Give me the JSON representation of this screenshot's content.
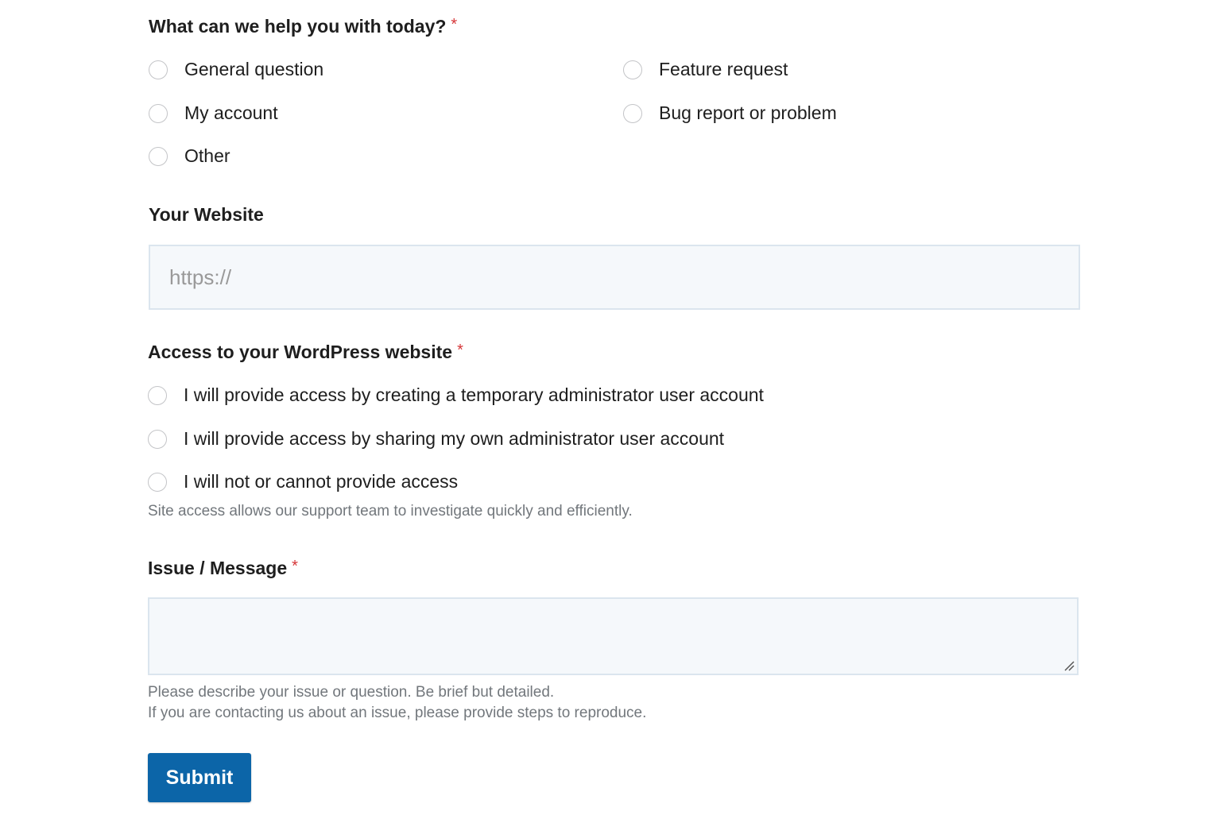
{
  "help_section": {
    "label": "What can we help you with today?",
    "required_mark": "*",
    "options": [
      {
        "label": "General question",
        "checked": false
      },
      {
        "label": "Feature request",
        "checked": false
      },
      {
        "label": "My account",
        "checked": false
      },
      {
        "label": "Bug report or problem",
        "checked": false
      },
      {
        "label": "Other",
        "checked": false
      }
    ]
  },
  "website": {
    "label": "Your Website",
    "placeholder": "https://",
    "value": ""
  },
  "access": {
    "label": "Access to your WordPress website",
    "required_mark": "*",
    "options": [
      {
        "label": "I will provide access by creating a temporary administrator user account",
        "checked": false
      },
      {
        "label": "I will provide access by sharing my own administrator user account",
        "checked": false
      },
      {
        "label": "I will not or cannot provide access",
        "checked": false
      }
    ],
    "help_text": "Site access allows our support team to investigate quickly and efficiently."
  },
  "message": {
    "label": "Issue / Message",
    "required_mark": "*",
    "value": "",
    "help_line1": "Please describe your issue or question. Be brief but detailed.",
    "help_line2": "If you are contacting us about an issue, please provide steps to reproduce."
  },
  "submit_label": "Submit",
  "colors": {
    "required": "#d63638",
    "button": "#0c65a8",
    "input_bg": "#f5f8fb",
    "input_border": "#dbe5ee"
  }
}
